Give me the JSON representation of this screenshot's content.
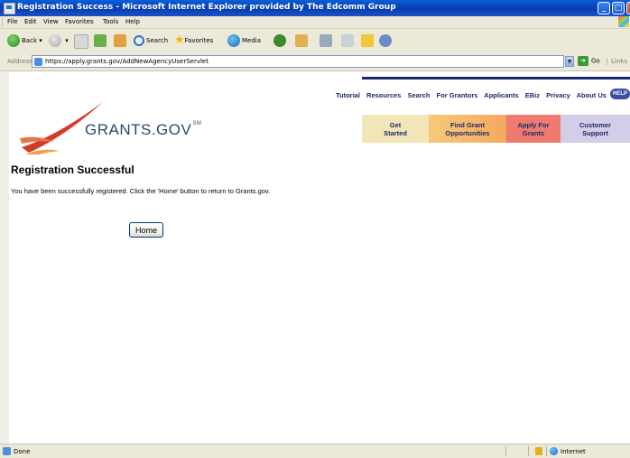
{
  "window": {
    "title": "Registration Success - Microsoft Internet Explorer provided by The Edcomm Group",
    "controls": {
      "minimize": "_",
      "maximize": "□"
    }
  },
  "menu": [
    "File",
    "Edit",
    "View",
    "Favorites",
    "Tools",
    "Help"
  ],
  "toolbar": {
    "back_label": "Back",
    "search_label": "Search",
    "favorites_label": "Favorites",
    "media_label": "Media"
  },
  "address": {
    "label": "Address",
    "url": "https://apply.grants.gov/AddNewAgencyUserServlet",
    "go_label": "Go",
    "links_label": "Links"
  },
  "site": {
    "brand": "GRANTS.GOV",
    "brand_mark": "SM",
    "top_nav": [
      "Tutorial",
      "Resources",
      "Search",
      "For Grantors",
      "Applicants",
      "EBiz",
      "Privacy",
      "About Us"
    ],
    "help_label": "HELP",
    "tabs": [
      {
        "line1": "Get",
        "line2": "Started",
        "color": "#f2e6b8"
      },
      {
        "line1": "Find Grant",
        "line2": "Opportunities",
        "color": "#f5a860"
      },
      {
        "line1": "Apply For",
        "line2": "Grants",
        "color": "#ee7a70"
      },
      {
        "line1": "Customer",
        "line2": "Support",
        "color": "#d4cde8"
      }
    ],
    "accent_color": "#1a2a6a"
  },
  "page": {
    "heading": "Registration Successful",
    "message": "You have been successfully registered. Click the 'Home' button to return to Grants.gov.",
    "home_button": "Home"
  },
  "status": {
    "text": "Done",
    "zone": "Internet"
  }
}
